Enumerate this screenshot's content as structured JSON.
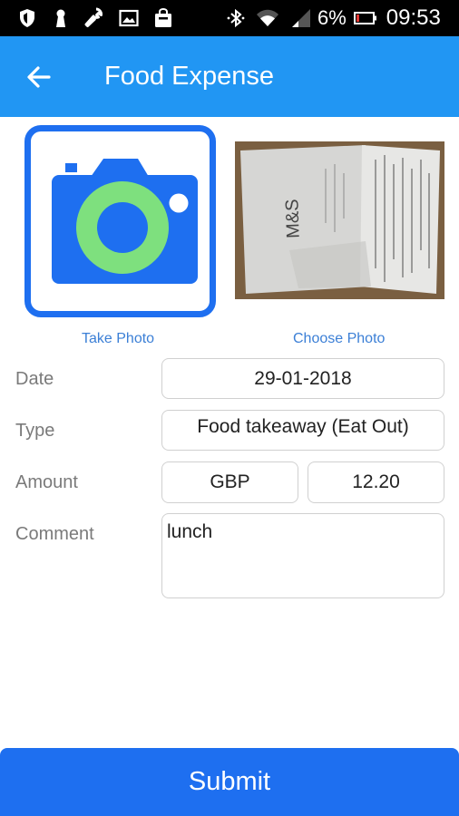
{
  "status_bar": {
    "battery_percent": "6%",
    "time": "09:53",
    "left_icons": [
      "shield-icon",
      "keyhole-icon",
      "wrench-icon",
      "image-icon",
      "bag-icon"
    ],
    "right_icons": [
      "bluetooth-icon",
      "wifi-icon",
      "signal-icon",
      "battery-icon"
    ]
  },
  "app_bar": {
    "title": "Food Expense",
    "back_icon": "arrow-left-icon"
  },
  "photos": {
    "take_photo_label": "Take Photo",
    "choose_photo_label": "Choose Photo",
    "receipt_store_text": "M&S"
  },
  "form": {
    "date_label": "Date",
    "date_value": "29-01-2018",
    "type_label": "Type",
    "type_value": "Food takeaway (Eat Out)",
    "amount_label": "Amount",
    "currency_value": "GBP",
    "amount_value": "12.20",
    "comment_label": "Comment",
    "comment_value": "lunch"
  },
  "submit_label": "Submit",
  "colors": {
    "app_bar": "#2196f3",
    "primary": "#1e6ff0",
    "lens_ring": "#7ee07e",
    "link": "#3b7fd6",
    "label": "#7a7a7a",
    "field_border": "#d0d0d0"
  }
}
